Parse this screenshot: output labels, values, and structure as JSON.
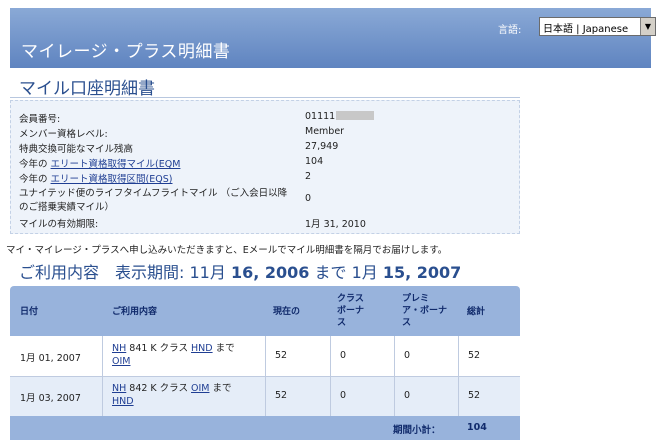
{
  "header": {
    "title": "マイレージ・プラス明細書",
    "language_label": "言語:",
    "language_selected": "日本語 | Japanese"
  },
  "account": {
    "title": "マイル口座明細書",
    "fields": [
      {
        "label": "会員番号:",
        "value": "01111"
      },
      {
        "label": "メンバー資格レベル:",
        "value": "Member"
      },
      {
        "label": "特典交換可能なマイル残高",
        "value": "27,949"
      },
      {
        "label_prefix": "今年の",
        "label_link": "エリート資格取得マイル(EQM",
        "value": "104"
      },
      {
        "label_prefix": "今年の",
        "label_link": "エリート資格取得区間(EQS)",
        "value": "2"
      },
      {
        "label": "ユナイテッド便のライフタイムフライトマイル （ご入会日以降",
        "label2": "のご搭乗実績マイル）",
        "value": "0"
      },
      {
        "label": "マイルの有効期限:",
        "value": "1月 31, 2010"
      }
    ]
  },
  "notice": "マイ・マイレージ・プラスへ申し込みいただきますと、Eメールでマイル明細書を隔月でお届けします。",
  "period": {
    "prefix": "ご利用内容　表示期間: 11月 ",
    "start_day": "16, 2006",
    "middle": " まで 1月 ",
    "end_day": "15, 2007"
  },
  "table": {
    "headers": {
      "date": "日付",
      "activity": "ご利用内容",
      "current_l1": "現在の",
      "class_l1": "クラス",
      "class_l2": "ボーナ",
      "class_l3": "ス",
      "premier_l1": "プレミ",
      "premier_l2": "ア・ボーナ",
      "premier_l3": "ス",
      "total": "総計"
    },
    "rows": [
      {
        "date": "1月 01, 2007",
        "carrier": "NH",
        "mid": " 841 K クラス ",
        "from": "HND",
        "to_word": " まで",
        "to": "OIM",
        "current": "52",
        "class_bonus": "0",
        "premier_bonus": "0",
        "total": "52"
      },
      {
        "date": "1月 03, 2007",
        "carrier": "NH",
        "mid": " 842 K クラス ",
        "from": "OIM",
        "to_word": " まで",
        "to": "HND",
        "current": "52",
        "class_bonus": "0",
        "premier_bonus": "0",
        "total": "52"
      }
    ],
    "footer_label": "期間小計：",
    "footer_total": "104"
  }
}
